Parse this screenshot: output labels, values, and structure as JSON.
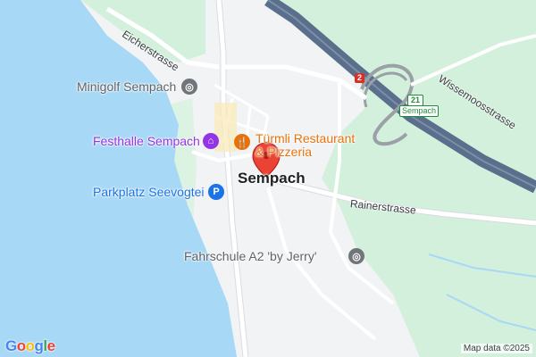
{
  "map": {
    "place_name": "Sempach",
    "streets": {
      "eicherstrasse": "Eicherstrasse",
      "rainerstrasse": "Rainerstrasse",
      "wissemoosstrasse": "Wissemoosstrasse"
    },
    "pois": {
      "minigolf": "Minigolf Sempach",
      "festhalle": "Festhalle Sempach",
      "parkplatz": "Parkplatz Seevogtei",
      "restaurant_line1": "Türmli Restaurant",
      "restaurant_line2": "& Pizzeria",
      "fahrschule": "Fahrschule A2 'by Jerry'"
    },
    "road_shields": {
      "motorway": "2",
      "exit_number": "21",
      "exit_name": "Sempach"
    },
    "parking_symbol": "P",
    "attribution": "Map data ©2025",
    "logo": "Google",
    "colors": {
      "water": "#a7d8f5",
      "park": "#c8ecd3",
      "land": "#f1f3f4",
      "motorway": "#5a6f8c",
      "marker": "#ea4335"
    }
  }
}
